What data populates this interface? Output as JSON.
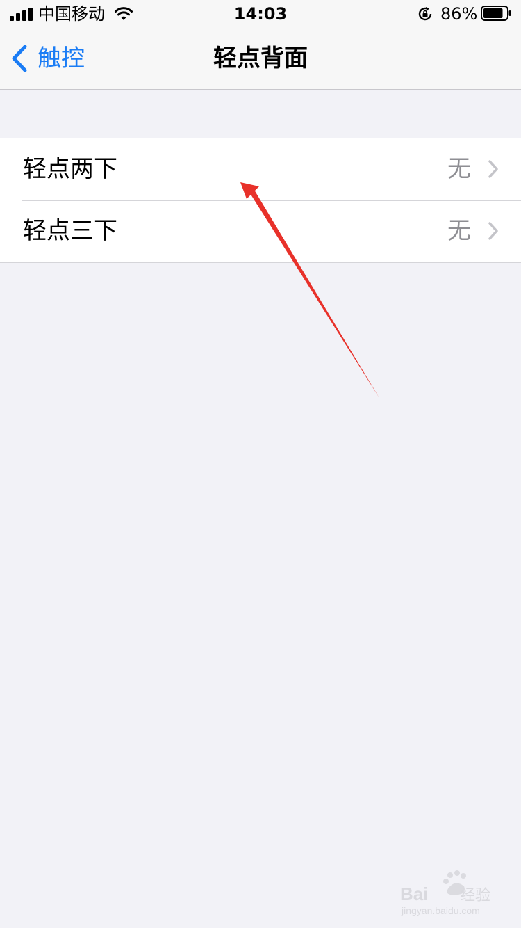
{
  "status_bar": {
    "carrier": "中国移动",
    "time": "14:03",
    "battery_percent": "86%",
    "battery_level": 0.86,
    "icons": [
      "signal-icon",
      "wifi-icon",
      "rotation-lock-icon",
      "battery-icon"
    ]
  },
  "nav": {
    "back_label": "触控",
    "title": "轻点背面",
    "accent_color": "#1a7cf5"
  },
  "list": {
    "items": [
      {
        "label": "轻点两下",
        "value": "无"
      },
      {
        "label": "轻点三下",
        "value": "无"
      }
    ]
  },
  "annotation": {
    "color": "#e8312a",
    "icon": "red-arrow-icon"
  },
  "watermark": {
    "brand": "Baidu经验",
    "url": "jingyan.baidu.com"
  }
}
